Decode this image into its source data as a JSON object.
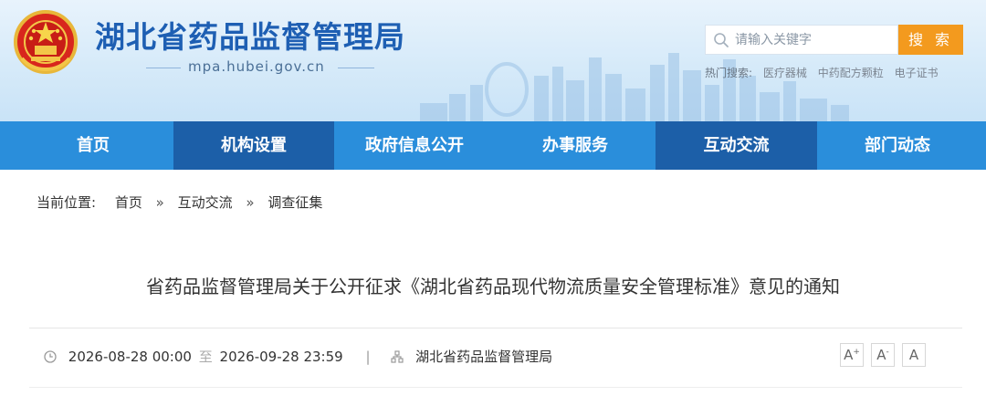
{
  "header": {
    "site_title": "湖北省药品监督管理局",
    "domain": "mpa.hubei.gov.cn",
    "emblem_icon": "national-emblem-icon",
    "colors": {
      "title": "#1e5fb3",
      "accent": "#f39a1e",
      "nav": "#2a8edb",
      "nav_active": "#1c5fa8"
    }
  },
  "search": {
    "placeholder": "请输入关键字",
    "button_label": "搜 索",
    "hot_label": "热门搜索:",
    "hot_links": [
      "医疗器械",
      "中药配方颗粒",
      "电子证书"
    ]
  },
  "nav": {
    "items": [
      {
        "label": "首页"
      },
      {
        "label": "机构设置"
      },
      {
        "label": "政府信息公开"
      },
      {
        "label": "办事服务"
      },
      {
        "label": "互动交流"
      },
      {
        "label": "部门动态"
      }
    ]
  },
  "breadcrumb": {
    "prefix": "当前位置:",
    "items": [
      "首页",
      "互动交流",
      "调查征集"
    ],
    "separator": "»"
  },
  "article": {
    "title": "省药品监督管理局关于公开征求《湖北省药品现代物流质量安全管理标准》意见的通知",
    "start_time": "2026-08-28 00:00",
    "to_label": "至",
    "end_time": "2026-09-28 23:59",
    "meta_separator": "|",
    "organization": "湖北省药品监督管理局",
    "font_controls": [
      {
        "label": "A",
        "mark": "+"
      },
      {
        "label": "A",
        "mark": "-"
      },
      {
        "label": "A",
        "mark": ""
      }
    ]
  }
}
